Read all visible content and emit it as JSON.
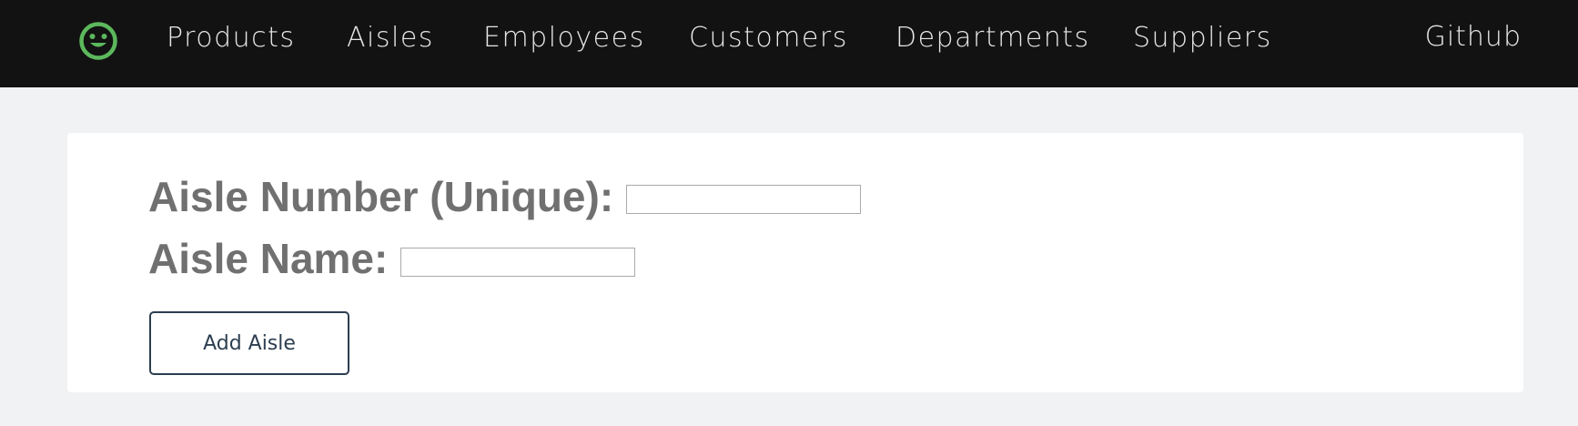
{
  "nav": {
    "logo_icon": "smiley-face-icon",
    "logo_color": "#5cb85c",
    "links": [
      {
        "label": "Products"
      },
      {
        "label": "Aisles"
      },
      {
        "label": "Employees"
      },
      {
        "label": "Customers"
      },
      {
        "label": "Departments"
      },
      {
        "label": "Suppliers"
      }
    ],
    "github_label": "Github"
  },
  "form": {
    "aisle_number_label": "Aisle Number (Unique):",
    "aisle_number_value": "",
    "aisle_name_label": "Aisle Name:",
    "aisle_name_value": "",
    "submit_label": "Add Aisle"
  },
  "colors": {
    "navbar_bg": "#121212",
    "page_bg": "#f1f2f4",
    "accent_green": "#5cb85c",
    "button_border": "#2c3e50",
    "label_gray": "#707070"
  }
}
